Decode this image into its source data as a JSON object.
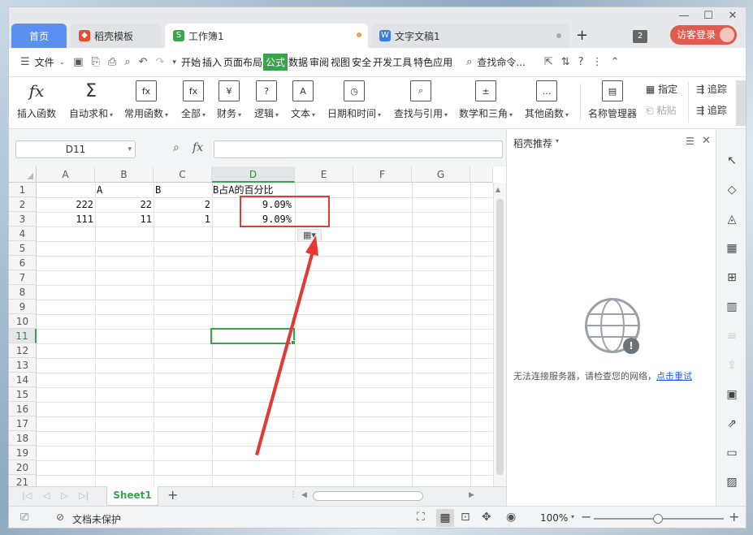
{
  "tabs": {
    "home": "首页",
    "template": "稻壳模板",
    "workbook": "工作簿1",
    "document": "文字文稿1",
    "new_tab": "+",
    "badge_count": "2",
    "login": "访客登录"
  },
  "menubar": {
    "file": "文件",
    "items": [
      "开始",
      "插入",
      "页面布局",
      "公式",
      "数据",
      "审阅",
      "视图",
      "安全",
      "开发工具",
      "特色应用"
    ],
    "active": "公式",
    "search": "查找命令..."
  },
  "ribbon": {
    "buttons": [
      {
        "label": "插入函数",
        "icon": "fx"
      },
      {
        "label": "自动求和",
        "icon": "Σ"
      },
      {
        "label": "常用函数",
        "icon": "fx"
      },
      {
        "label": "全部",
        "icon": "fx"
      },
      {
        "label": "财务",
        "icon": "¥"
      },
      {
        "label": "逻辑",
        "icon": "?"
      },
      {
        "label": "文本",
        "icon": "A"
      },
      {
        "label": "日期和时间",
        "icon": "◷"
      },
      {
        "label": "查找与引用",
        "icon": "⌕"
      },
      {
        "label": "数学和三角",
        "icon": "±"
      },
      {
        "label": "其他函数",
        "icon": "…"
      },
      {
        "label": "名称管理器",
        "icon": "▤"
      }
    ],
    "define": "指定",
    "paste": "粘贴",
    "trace1": "追踪",
    "trace2": "追踪"
  },
  "formula_bar": {
    "name_box": "D11",
    "fx": "fx",
    "formula": ""
  },
  "sheet": {
    "columns": [
      "A",
      "B",
      "C",
      "D",
      "E",
      "F",
      "G"
    ],
    "rows": [
      "1",
      "2",
      "3",
      "4",
      "5",
      "6",
      "7",
      "8",
      "9",
      "10",
      "11",
      "12",
      "13",
      "14",
      "15",
      "16",
      "17",
      "18",
      "19",
      "20",
      "21"
    ],
    "cells": {
      "B1": "A",
      "C1": "B",
      "D1": "B占A的百分比",
      "A2": "222",
      "B2": "22",
      "C2": "2",
      "D2": "9.09%",
      "A3": "111",
      "B3": "11",
      "C3": "1",
      "D3": "9.09%"
    },
    "selected_cell": "D11",
    "highlight_color": "#e53935",
    "selection_color": "#3aa34d"
  },
  "sheet_tabs": {
    "active": "Sheet1",
    "add": "+"
  },
  "status": {
    "protect": "文档未保护",
    "zoom": "100%"
  },
  "panel": {
    "title": "稻壳推荐",
    "message": "无法连接服务器，请检查您的网络，",
    "retry": "点击重试"
  }
}
